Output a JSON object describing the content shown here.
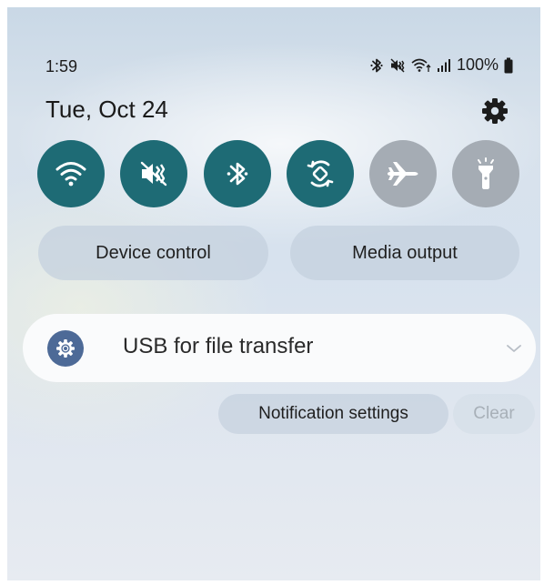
{
  "status_bar": {
    "time": "1:59",
    "battery": "100%",
    "icons": [
      "bluetooth-icon",
      "mute-icon",
      "wifi-data-icon",
      "signal-icon",
      "battery-icon"
    ]
  },
  "header": {
    "date": "Tue, Oct 24",
    "settings_icon": "gear-icon"
  },
  "quick_toggles": [
    {
      "name": "wifi",
      "icon": "wifi-icon",
      "state": "on"
    },
    {
      "name": "mute",
      "icon": "mute-icon",
      "state": "on"
    },
    {
      "name": "bluetooth",
      "icon": "bluetooth-icon",
      "state": "on"
    },
    {
      "name": "auto-rotate",
      "icon": "rotate-icon",
      "state": "on"
    },
    {
      "name": "airplane",
      "icon": "airplane-icon",
      "state": "off"
    },
    {
      "name": "flashlight",
      "icon": "flashlight-icon",
      "state": "off"
    }
  ],
  "buttons": {
    "device_control": "Device control",
    "media_output": "Media output"
  },
  "notification": {
    "title": "USB for file transfer",
    "icon": "usb-settings-icon"
  },
  "actions": {
    "notification_settings": "Notification settings",
    "clear": "Clear"
  },
  "colors": {
    "toggle_on": "#1e6b75",
    "toggle_off": "#a5acb4",
    "notif_icon_bg": "#4d6a97"
  }
}
